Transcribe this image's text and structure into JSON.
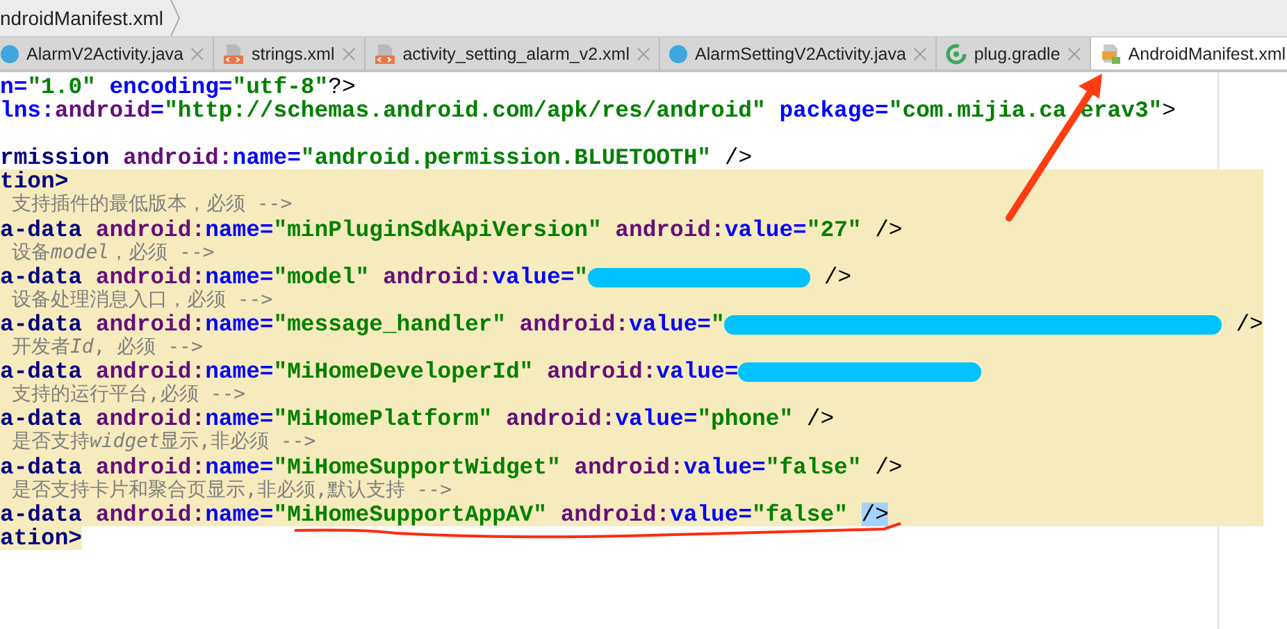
{
  "breadcrumb": {
    "label": "ndroidManifest.xml"
  },
  "tabs": [
    {
      "label": "AlarmV2Activity.java",
      "kind": "class",
      "selected": false
    },
    {
      "label": "strings.xml",
      "kind": "xml",
      "selected": false
    },
    {
      "label": "activity_setting_alarm_v2.xml",
      "kind": "xml",
      "selected": false
    },
    {
      "label": "AlarmSettingV2Activity.java",
      "kind": "class",
      "selected": false
    },
    {
      "label": "plug.gradle",
      "kind": "gradle",
      "selected": false
    },
    {
      "label": "AndroidManifest.xml",
      "kind": "manifest",
      "selected": true
    }
  ],
  "lines": [
    {
      "highlighted": false,
      "tokens": [
        {
          "kind": "attr",
          "text": "n="
        },
        {
          "kind": "string",
          "text": "\"1.0\""
        },
        {
          "kind": "attr",
          "text": " encoding="
        },
        {
          "kind": "string",
          "text": "\"utf-8\""
        },
        {
          "kind": "punct",
          "text": "?>"
        }
      ]
    },
    {
      "highlighted": false,
      "tokens": [
        {
          "kind": "attr",
          "text": "lns:"
        },
        {
          "kind": "ns",
          "text": "android"
        },
        {
          "kind": "attr",
          "text": "="
        },
        {
          "kind": "string",
          "text": "\"http://schemas.android.com/apk/res/android\""
        },
        {
          "kind": "attr",
          "text": " package="
        },
        {
          "kind": "string",
          "text": "\"com.mijia.ca"
        },
        {
          "kind": "covered"
        },
        {
          "kind": "string",
          "text": "erav3\""
        },
        {
          "kind": "punct",
          "text": ">"
        }
      ]
    },
    {
      "highlighted": false
    },
    {
      "highlighted": false,
      "tokens": [
        {
          "kind": "tag",
          "text": "rmission"
        },
        {
          "kind": "ns",
          "text": " android:"
        },
        {
          "kind": "attr",
          "text": "name="
        },
        {
          "kind": "string",
          "text": "\"android.permission.BLUETOOTH\""
        },
        {
          "kind": "punct",
          "text": " />"
        }
      ]
    },
    {
      "highlighted": true,
      "tokens": [
        {
          "kind": "tag",
          "text": "tion>"
        }
      ]
    },
    {
      "highlighted": true,
      "tokens": [
        {
          "kind": "comment",
          "text": " 支持插件的最低版本，必须 -->"
        }
      ]
    },
    {
      "highlighted": true,
      "tokens": [
        {
          "kind": "tag",
          "text": "a-data"
        },
        {
          "kind": "ns",
          "text": " android:"
        },
        {
          "kind": "attr",
          "text": "name="
        },
        {
          "kind": "string",
          "text": "\"minPluginSdkApiVersion\""
        },
        {
          "kind": "ns",
          "text": " android:"
        },
        {
          "kind": "attr",
          "text": "value="
        },
        {
          "kind": "string",
          "text": "\"27\""
        },
        {
          "kind": "punct",
          "text": " />"
        }
      ]
    },
    {
      "highlighted": true,
      "tokens": [
        {
          "kind": "comment",
          "text": " 设备"
        },
        {
          "kind": "comment-italic",
          "text": "model"
        },
        {
          "kind": "comment",
          "text": "，必须 -->"
        }
      ]
    },
    {
      "highlighted": true,
      "tokens": [
        {
          "kind": "tag",
          "text": "a-data"
        },
        {
          "kind": "ns",
          "text": " android:"
        },
        {
          "kind": "attr",
          "text": "name="
        },
        {
          "kind": "string",
          "text": "\"model\""
        },
        {
          "kind": "ns",
          "text": " android:"
        },
        {
          "kind": "attr",
          "text": "value="
        },
        {
          "kind": "string",
          "text": "\""
        },
        {
          "kind": "redacted"
        },
        {
          "kind": "punct",
          "text": " />"
        }
      ]
    },
    {
      "highlighted": true,
      "tokens": [
        {
          "kind": "comment",
          "text": " 设备处理消息入口，必须 -->"
        }
      ]
    },
    {
      "highlighted": true,
      "tokens": [
        {
          "kind": "tag",
          "text": "a-data"
        },
        {
          "kind": "ns",
          "text": " android:"
        },
        {
          "kind": "attr",
          "text": "name="
        },
        {
          "kind": "string",
          "text": "\"message_handler\""
        },
        {
          "kind": "ns",
          "text": " android:"
        },
        {
          "kind": "attr",
          "text": "value="
        },
        {
          "kind": "string",
          "text": "\""
        },
        {
          "kind": "redacted"
        },
        {
          "kind": "punct",
          "text": " />"
        }
      ]
    },
    {
      "highlighted": true,
      "tokens": [
        {
          "kind": "comment",
          "text": " 开发者"
        },
        {
          "kind": "comment-italic",
          "text": "Id"
        },
        {
          "kind": "comment",
          "text": ", 必须 -->"
        }
      ]
    },
    {
      "highlighted": true,
      "tokens": [
        {
          "kind": "tag",
          "text": "a-data"
        },
        {
          "kind": "ns",
          "text": " android:"
        },
        {
          "kind": "attr",
          "text": "name="
        },
        {
          "kind": "string",
          "text": "\"MiHomeDeveloperId\""
        },
        {
          "kind": "ns",
          "text": " android:"
        },
        {
          "kind": "attr",
          "text": "value="
        },
        {
          "kind": "redacted"
        }
      ]
    },
    {
      "highlighted": true,
      "tokens": [
        {
          "kind": "comment",
          "text": " 支持的运行平台,必须 -->"
        }
      ]
    },
    {
      "highlighted": true,
      "tokens": [
        {
          "kind": "tag",
          "text": "a-data"
        },
        {
          "kind": "ns",
          "text": " android:"
        },
        {
          "kind": "attr",
          "text": "name="
        },
        {
          "kind": "string",
          "text": "\"MiHomePlatform\""
        },
        {
          "kind": "ns",
          "text": " android:"
        },
        {
          "kind": "attr",
          "text": "value="
        },
        {
          "kind": "string",
          "text": "\"phone\""
        },
        {
          "kind": "punct",
          "text": " />"
        }
      ]
    },
    {
      "highlighted": true,
      "tokens": [
        {
          "kind": "comment",
          "text": " 是否支持"
        },
        {
          "kind": "comment-italic",
          "text": "widget"
        },
        {
          "kind": "comment",
          "text": "显示,非必须 -->"
        }
      ]
    },
    {
      "highlighted": true,
      "tokens": [
        {
          "kind": "tag",
          "text": "a-data"
        },
        {
          "kind": "ns",
          "text": " android:"
        },
        {
          "kind": "attr",
          "text": "name="
        },
        {
          "kind": "string",
          "text": "\"MiHomeSupportWidget\""
        },
        {
          "kind": "ns",
          "text": " android:"
        },
        {
          "kind": "attr",
          "text": "value="
        },
        {
          "kind": "string",
          "text": "\"false\""
        },
        {
          "kind": "punct",
          "text": " />"
        }
      ]
    },
    {
      "highlighted": true,
      "tokens": [
        {
          "kind": "comment",
          "text": " 是否支持卡片和聚合页显示,非必须,默认支持 -->"
        }
      ]
    },
    {
      "highlighted": true,
      "tokens": [
        {
          "kind": "tag",
          "text": "a-data"
        },
        {
          "kind": "ns",
          "text": " android:"
        },
        {
          "kind": "attr",
          "text": "name="
        },
        {
          "kind": "string",
          "text": "\"MiHomeSupportAppAV\""
        },
        {
          "kind": "ns",
          "text": " android:"
        },
        {
          "kind": "attr",
          "text": "value="
        },
        {
          "kind": "string",
          "text": "\"false\""
        },
        {
          "kind": "selected",
          "text": "/>"
        }
      ]
    },
    {
      "highlighted": false,
      "tokens": [
        {
          "kind": "matchedtag",
          "text": "ation>"
        }
      ]
    }
  ]
}
